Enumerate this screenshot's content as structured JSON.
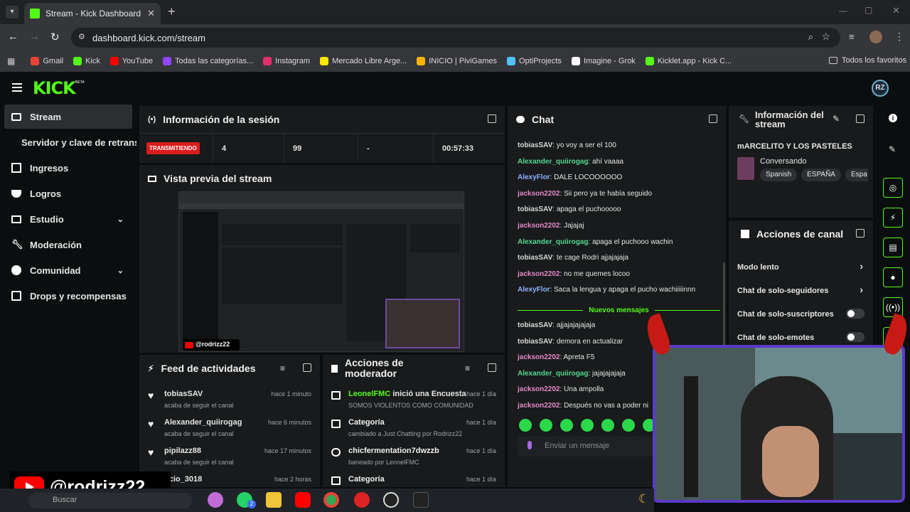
{
  "browser": {
    "tab_title": "Stream - Kick Dashboard",
    "new_tab": "+",
    "url": "dashboard.kick.com/stream",
    "bookmarks": [
      {
        "label": "Gmail",
        "color": "#ea4335"
      },
      {
        "label": "Kick",
        "color": "#53fc18"
      },
      {
        "label": "YouTube",
        "color": "#ff0000"
      },
      {
        "label": "Todas las categorías...",
        "color": "#9146ff"
      },
      {
        "label": "Instagram",
        "color": "#e1306c"
      },
      {
        "label": "Mercado Libre Arge...",
        "color": "#ffe600"
      },
      {
        "label": "INICIO | PiviGames",
        "color": "#f4b400"
      },
      {
        "label": "OptiProjects",
        "color": "#4fc3f7"
      },
      {
        "label": "Imagine - Grok",
        "color": "#ffffff"
      },
      {
        "label": "Kicklet.app - Kick C...",
        "color": "#53fc18"
      }
    ],
    "all_bookmarks": "Todos los favoritos"
  },
  "app": {
    "logo": "KICK",
    "beta": "BETA",
    "avatar": "RZ",
    "accent": "#53fc18"
  },
  "sidebar": {
    "items": [
      {
        "label": "Stream",
        "icon": "stream-icon"
      },
      {
        "label": "Servidor y clave de retransm",
        "icon": ""
      },
      {
        "label": "Ingresos",
        "icon": "ingresos-icon"
      },
      {
        "label": "Logros",
        "icon": "trophy-icon"
      },
      {
        "label": "Estudio",
        "icon": "studio-icon"
      },
      {
        "label": "Moderación",
        "icon": "wrench-icon"
      },
      {
        "label": "Comunidad",
        "icon": "community-icon"
      },
      {
        "label": "Drops y recompensas",
        "icon": "drops-icon"
      }
    ]
  },
  "session": {
    "title": "Información de la sesión",
    "status": "TRANSMITIENDO",
    "viewers": "4",
    "followers": "99",
    "subs": "-",
    "duration": "00:57:33"
  },
  "preview": {
    "title": "Vista previa del stream",
    "handle": "@rodrizz22"
  },
  "feed": {
    "title": "Feed de actividades",
    "items": [
      {
        "user": "tobiasSAV",
        "action": "acaba de seguir el canal",
        "time": "hace 1 minuto"
      },
      {
        "user": "Alexander_quiirogag",
        "action": "acaba de seguir el canal",
        "time": "hace 6 minutos"
      },
      {
        "user": "pipilazz88",
        "action": "acaba de seguir el canal",
        "time": "hace 17 minutos"
      },
      {
        "user": "ucio_3018",
        "action": "",
        "time": "hace 2 horas"
      }
    ]
  },
  "modactions": {
    "title": "Acciones de moderador",
    "items": [
      {
        "actor": "LeonelFMC",
        "verb": " inició una Encuesta",
        "detail": "SOMOS VIOLENTOS COMO COMUNIDAD",
        "time": "hace 1 día"
      },
      {
        "actor": "Categoría",
        "verb": "",
        "detail": "cambiado a Just Chatting por Rodrizz22",
        "time": "hace 1 día"
      },
      {
        "actor": "chicfermentation7dwzzb",
        "verb": "",
        "detail": "baneado por LeonelFMC",
        "time": "hace 1 día"
      },
      {
        "actor": "Categoría",
        "verb": "",
        "detail": "",
        "time": "hace 1 día"
      }
    ]
  },
  "chat": {
    "title": "Chat",
    "new_messages": "Nuevos mensajes",
    "placeholder": "Enviar un mensaje",
    "messages": [
      {
        "user": "tobiasSAV",
        "text": "yo voy a ser el 100",
        "color": "#d9d9d9"
      },
      {
        "user": "Alexander_quiirogag",
        "text": "ahí vaaaa",
        "color": "#53d892"
      },
      {
        "user": "AlexyFlor",
        "text": "DALE LOCOOOOOO",
        "color": "#8fb1ff"
      },
      {
        "user": "jackson2202",
        "text": "Sii pero ya te había seguido",
        "color": "#e38ac9"
      },
      {
        "user": "tobiasSAV",
        "text": "apaga el puchooooo",
        "color": "#d9d9d9"
      },
      {
        "user": "jackson2202",
        "text": "Jajajaj",
        "color": "#e38ac9"
      },
      {
        "user": "Alexander_quiirogag",
        "text": "apaga el puchooo wachin",
        "color": "#53d892"
      },
      {
        "user": "tobiasSAV",
        "text": "te cage Rodri ajjajajaja",
        "color": "#d9d9d9"
      },
      {
        "user": "jackson2202",
        "text": "no me quemes locoo",
        "color": "#e38ac9"
      },
      {
        "user": "AlexyFlor",
        "text": "Saca la lengua y apaga el pucho wachiiiiinnn",
        "color": "#8fb1ff"
      },
      {
        "user": "tobiasSAV",
        "text": "ajjajajajajaja",
        "color": "#d9d9d9"
      },
      {
        "user": "tobiasSAV",
        "text": "demora en actualizar",
        "color": "#d9d9d9"
      },
      {
        "user": "jackson2202",
        "text": "Apreta F5",
        "color": "#e38ac9"
      },
      {
        "user": "Alexander_quiirogag",
        "text": "jajajajajaja",
        "color": "#53d892"
      },
      {
        "user": "jackson2202",
        "text": "Una ampolla",
        "color": "#e38ac9"
      },
      {
        "user": "jackson2202",
        "text": "Después no vas a poder ni",
        "color": "#e38ac9"
      }
    ]
  },
  "streaminfo": {
    "title_line1": "Información del",
    "title_line2": "stream",
    "stream_title": "mARCELITO Y LOS PASTELES",
    "category": "Conversando",
    "tags": [
      "Spanish",
      "ESPAÑA",
      "Espa"
    ]
  },
  "channelactions": {
    "title": "Acciones de canal",
    "items": [
      {
        "label": "Modo lento",
        "kind": "chevron"
      },
      {
        "label": "Chat de solo-seguidores",
        "kind": "chevron"
      },
      {
        "label": "Chat de solo-suscriptores",
        "kind": "toggle"
      },
      {
        "label": "Chat de solo-emotes",
        "kind": "toggle"
      }
    ]
  },
  "overlay": {
    "handle": "@rodrizz22",
    "taskbar_search": "Buscar",
    "whatsapp_badge": "2"
  }
}
